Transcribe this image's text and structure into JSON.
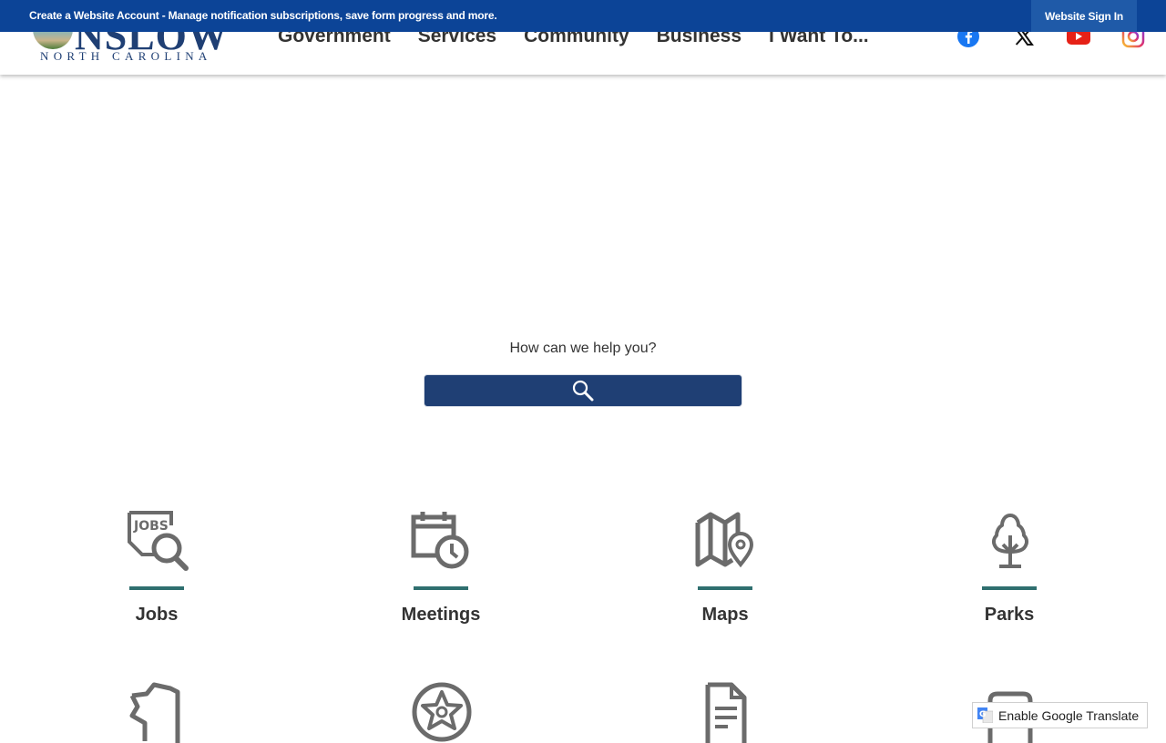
{
  "topbar": {
    "message": "Create a Website Account - Manage notification subscriptions, save form progress and more.",
    "signin_label": "Website Sign In",
    "bg_color": "#0c4497"
  },
  "logo": {
    "word": "NSLOW",
    "subtitle": "NORTH CAROLINA"
  },
  "nav": {
    "items": [
      "Government",
      "Services",
      "Community",
      "Business",
      "I Want To..."
    ]
  },
  "social": {
    "icons": [
      "facebook-icon",
      "x-icon",
      "youtube-icon",
      "instagram-icon"
    ]
  },
  "search": {
    "label": "How can we help you?",
    "button_color": "#1f3f74"
  },
  "quick_links": [
    {
      "label": "Jobs",
      "icon": "jobs-search-icon"
    },
    {
      "label": "Meetings",
      "icon": "calendar-clock-icon"
    },
    {
      "label": "Maps",
      "icon": "map-pin-icon"
    },
    {
      "label": "Parks",
      "icon": "tree-icon"
    }
  ],
  "quick_links_row2_icons": [
    "county-shape-icon",
    "sheriff-badge-icon",
    "document-icon",
    "clipboard-icon"
  ],
  "translate": {
    "label": "Enable Google Translate"
  }
}
